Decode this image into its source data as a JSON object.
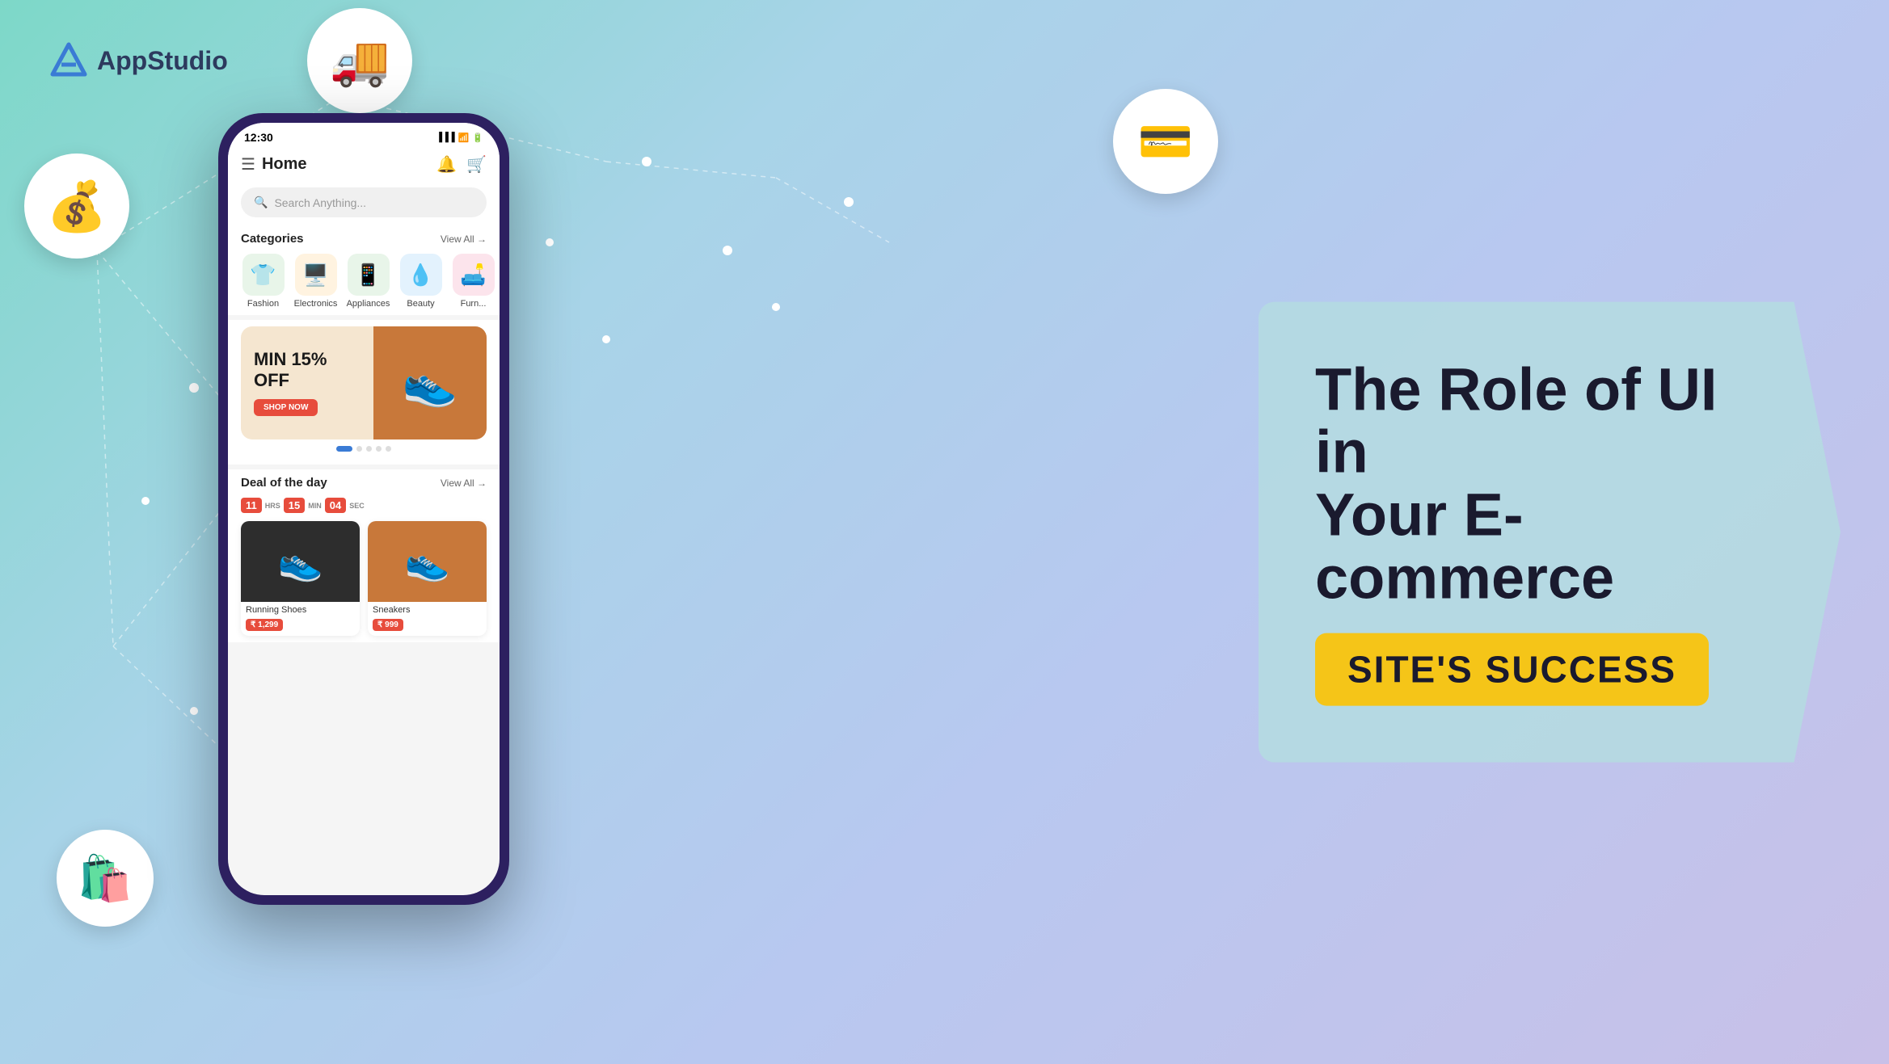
{
  "brand": {
    "name": "AppStudio",
    "logo_letter": "A"
  },
  "hero": {
    "heading_line1": "The Role of UI in",
    "heading_line2": "Your E-commerce",
    "success_label": "SITE'S SUCCESS"
  },
  "phone": {
    "status_time": "12:30",
    "header_title": "Home",
    "search_placeholder": "Search Anything...",
    "categories_title": "Categories",
    "categories_view_all": "View All →",
    "categories": [
      {
        "label": "Fashion",
        "icon": "👕",
        "bg": "cat-fashion"
      },
      {
        "label": "Electronics",
        "icon": "🖥️",
        "bg": "cat-electronics"
      },
      {
        "label": "Appliances",
        "icon": "📱",
        "bg": "cat-appliances"
      },
      {
        "label": "Beauty",
        "icon": "💧",
        "bg": "cat-beauty"
      },
      {
        "label": "Furn...",
        "icon": "🛋️",
        "bg": "cat-furniture"
      }
    ],
    "banner": {
      "title": "MIN 15%",
      "subtitle": "OFF",
      "shop_now": "SHOP NOW",
      "image_emoji": "👟"
    },
    "deal_title": "Deal of the day",
    "deal_view_all": "View All →",
    "timer": {
      "hours": "11",
      "hrs_label": "HRS",
      "minutes": "15",
      "min_label": "MIN",
      "seconds": "04",
      "sec_label": "SEC"
    },
    "products": [
      {
        "label": "Running Shoes",
        "price": "₹ 1,299",
        "emoji": "👟",
        "bg": "dark"
      },
      {
        "label": "Sneakers",
        "price": "₹ 999",
        "emoji": "👟",
        "bg": "orange"
      }
    ]
  },
  "float_icons": {
    "truck": "🚚",
    "money": "💰",
    "card": "💳",
    "bag": "🛍️"
  }
}
